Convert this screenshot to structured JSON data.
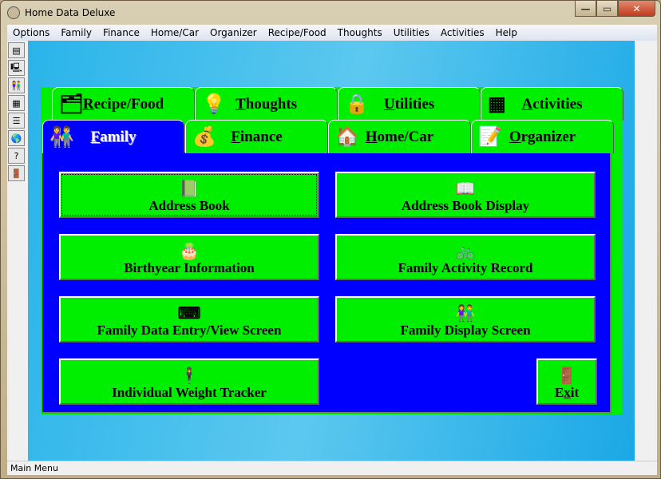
{
  "window": {
    "title": "Home Data Deluxe",
    "controls": [
      "minimize",
      "maximize",
      "close"
    ]
  },
  "menu": [
    "Options",
    "Family",
    "Finance",
    "Home/Car",
    "Organizer",
    "Recipe/Food",
    "Thoughts",
    "Utilities",
    "Activities",
    "Help"
  ],
  "toolbar": [
    {
      "icon": "notepad-icon",
      "g": "▤"
    },
    {
      "icon": "computer-icon",
      "g": "🖳"
    },
    {
      "icon": "people-icon",
      "g": "👫"
    },
    {
      "icon": "calendar-icon",
      "g": "▦"
    },
    {
      "icon": "list-icon",
      "g": "☰"
    },
    {
      "icon": "globe-icon",
      "g": "🌎"
    },
    {
      "icon": "help-icon",
      "g": "?"
    },
    {
      "icon": "exit-door-icon",
      "g": "🚪"
    }
  ],
  "tabs_back": [
    {
      "label": "Recipe/Food",
      "key": "R",
      "rest": "ecipe/Food",
      "icon": "file-box-icon",
      "g": "🗂"
    },
    {
      "label": "Thoughts",
      "key": "T",
      "rest": "houghts",
      "icon": "lightbulb-icon",
      "g": "💡"
    },
    {
      "label": "Utilities",
      "key": "U",
      "rest": "tilities",
      "icon": "padlock-icon",
      "g": "🔒"
    },
    {
      "label": "Activities",
      "key": "A",
      "rest": "ctivities",
      "icon": "crossword-icon",
      "g": "▦"
    }
  ],
  "tabs_front": [
    {
      "label": "Family",
      "key": "F",
      "rest": "amily",
      "icon": "family-icon",
      "g": "👫",
      "selected": true
    },
    {
      "label": "Finance",
      "key": "F",
      "rest": "inance",
      "icon": "moneybag-icon",
      "g": "💰"
    },
    {
      "label": "Home/Car",
      "key": "H",
      "rest": "ome/Car",
      "icon": "house-car-icon",
      "g": "🏠"
    },
    {
      "label": "Organizer",
      "key": "O",
      "rest": "rganizer",
      "icon": "notepad-pen-icon",
      "g": "📝"
    }
  ],
  "buttons": [
    {
      "label": "Address Book",
      "icon": "address-book-icon",
      "g": "📗"
    },
    {
      "label": "Address Book Display",
      "icon": "open-book-icon",
      "g": "📖"
    },
    {
      "label": "Birthyear Information",
      "icon": "birthday-cake-icon",
      "g": "🎂"
    },
    {
      "label": "Family Activity Record",
      "icon": "bicycle-icon",
      "g": "🚲"
    },
    {
      "label": "Family Data Entry/View Screen",
      "icon": "keyboard-icon",
      "g": "⌨"
    },
    {
      "label": "Family Display Screen",
      "icon": "couple-icon",
      "g": "👫"
    },
    {
      "label": "Individual Weight Tracker",
      "icon": "person-icon",
      "g": "🕴"
    }
  ],
  "exit": {
    "label": "Exit",
    "pre": "E",
    "key": "x",
    "post": "it",
    "icon": "exit-door-icon",
    "g": "🚪"
  },
  "status": "Main Menu",
  "colors": {
    "tab_green": "#00ee00",
    "panel_blue": "#0000ff"
  }
}
